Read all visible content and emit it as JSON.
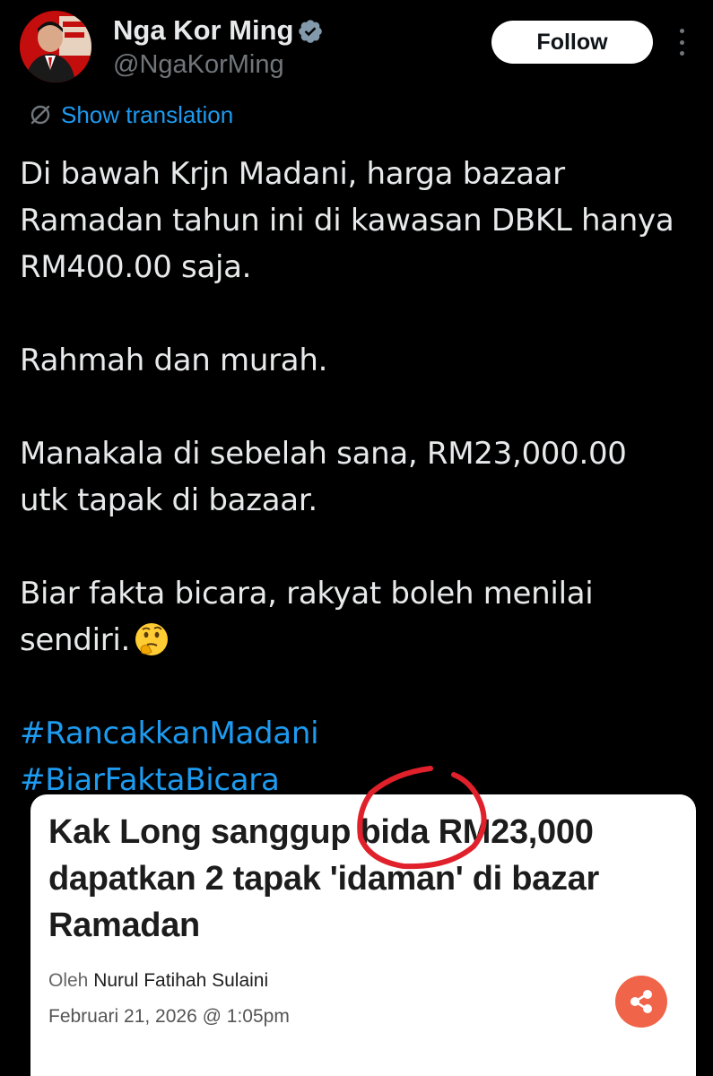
{
  "author": {
    "name": "Nga Kor Ming",
    "handle": "@NgaKorMing",
    "verified": true,
    "avatar_icon": "profile-photo"
  },
  "follow_label": "Follow",
  "translate_label": "Show translation",
  "tweet": {
    "paragraphs": [
      [
        "Di bawah Krjn Madani, harga bazaar",
        "Ramadan tahun ini di kawasan DBKL hanya",
        "RM400.00 saja."
      ],
      [
        "Rahmah dan murah."
      ],
      [
        "Manakala di sebelah sana, RM23,000.00",
        "utk tapak di bazaar."
      ],
      [
        "Biar fakta bicara, rakyat boleh menilai",
        "sendiri."
      ]
    ],
    "emoji": "thinking-face",
    "hashtags": [
      "#RancakkanMadani",
      "#BiarFaktaBicara"
    ]
  },
  "article": {
    "title_lines": [
      "Kak Long sanggup bida RM23,000",
      "dapatkan 2 tapak 'idaman' di bazar",
      "Ramadan"
    ],
    "byline_prefix": "Oleh",
    "byline_author": "Nurul Fatihah Sulaini",
    "date": "Februari 21, 2026 @ 1:05pm",
    "share_icon": "share-icon"
  },
  "colors": {
    "background": "#000000",
    "text": "#e7e9ea",
    "muted": "#71767b",
    "link": "#1d9bf0",
    "verified": "#829aab",
    "share_button": "#f06449",
    "annotation": "#e0202a"
  }
}
